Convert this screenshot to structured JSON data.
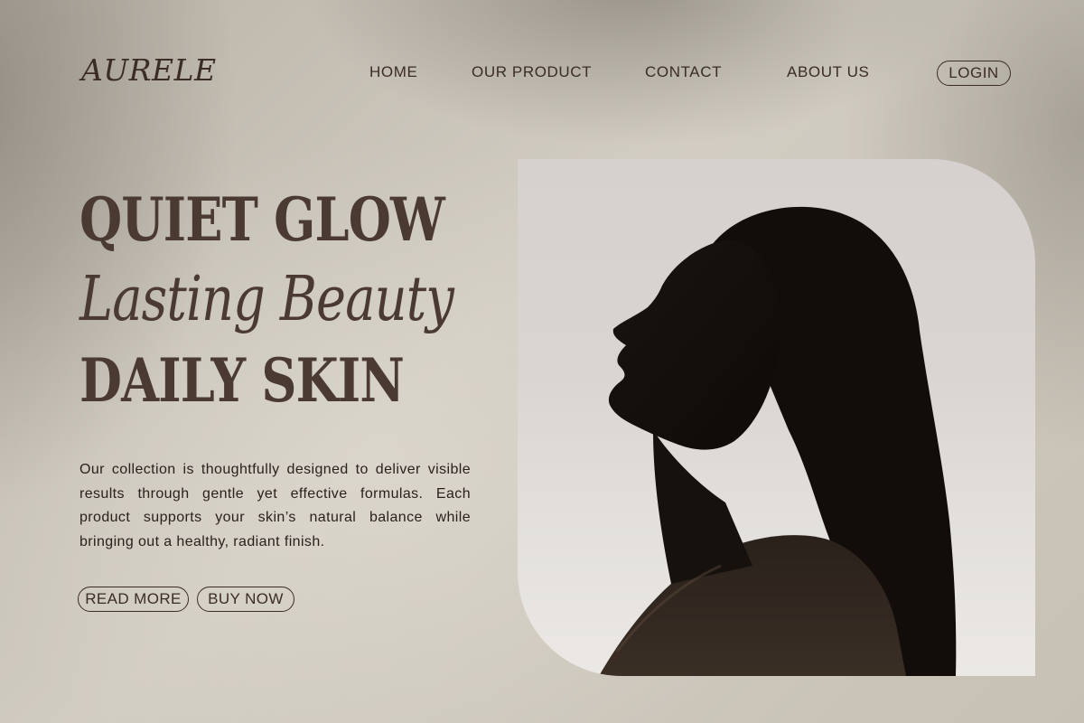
{
  "brand": {
    "logo": "AURELE"
  },
  "nav": {
    "items": [
      {
        "label": "HOME"
      },
      {
        "label": "OUR PRODUCT"
      },
      {
        "label": "CONTACT"
      },
      {
        "label": "ABOUT US"
      }
    ],
    "login_label": "LOGIN"
  },
  "hero": {
    "line1": "QUIET GLOW",
    "line2": "Lasting Beauty",
    "line3": "DAILY SKIN",
    "description": "Our collection is thoughtfully designed to deliver visible results through gentle yet effective formulas. Each product supports your skin’s natural balance while bringing out a healthy, radiant finish.",
    "read_more_label": "READ MORE",
    "buy_now_label": "BUY NOW"
  },
  "colors": {
    "background": "#cbc6bb",
    "text_dark": "#3b2c25",
    "heading": "#4a3a31"
  }
}
